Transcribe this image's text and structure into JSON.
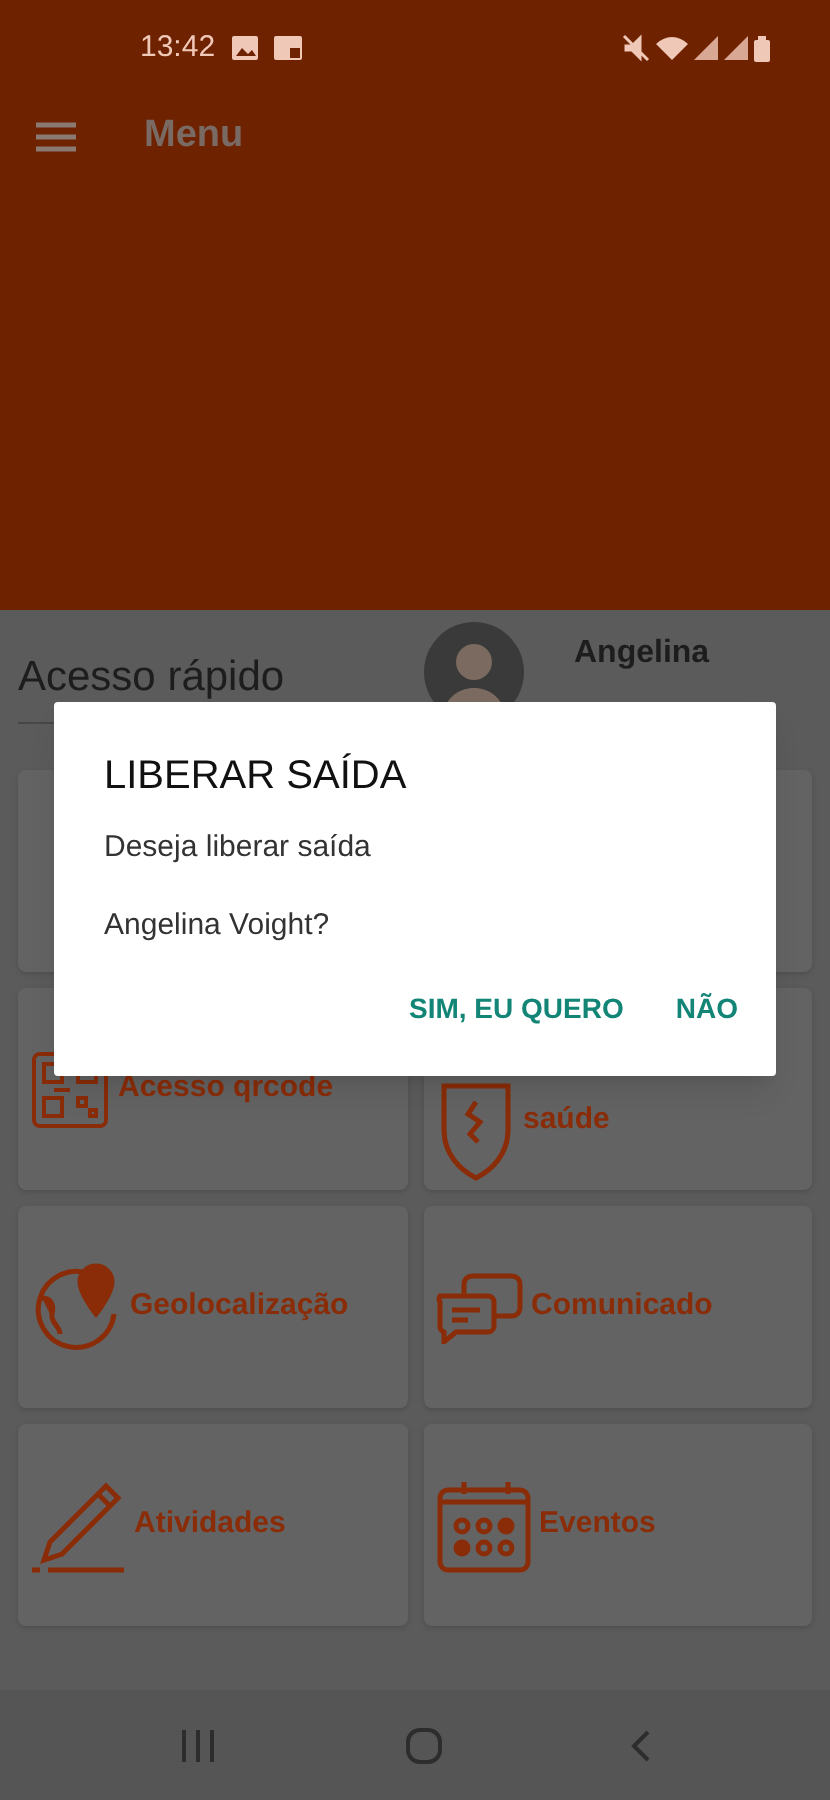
{
  "status_bar": {
    "time": "13:42"
  },
  "app_bar": {
    "title": "Menu"
  },
  "quick_access": {
    "title": "Acesso rápido",
    "user_name": "Angelina"
  },
  "cards": [
    {
      "kind": "blank"
    },
    {
      "kind": "blank"
    },
    {
      "kind": "qrcode",
      "label": "Acesso qrcode"
    },
    {
      "kind": "shield",
      "label": "saúde"
    },
    {
      "kind": "geo",
      "label": "Geolocalização"
    },
    {
      "kind": "chat",
      "label": "Comunicado"
    },
    {
      "kind": "pencil",
      "label": "Atividades"
    },
    {
      "kind": "calendar",
      "label": "Eventos"
    }
  ],
  "dialog": {
    "title": "LIBERAR SAÍDA",
    "message_lines": [
      "Deseja liberar saída",
      "Angelina Voight?"
    ],
    "buttons": [
      "SIM, EU QUERO",
      "NÃO"
    ]
  }
}
